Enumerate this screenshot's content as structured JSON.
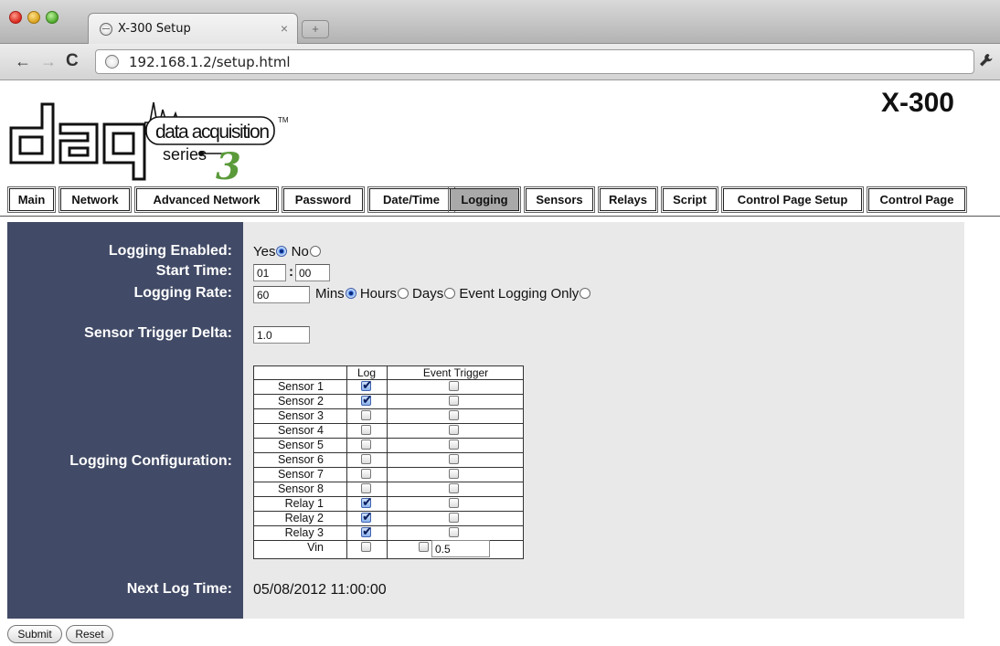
{
  "browser": {
    "tab_title": "X-300 Setup",
    "tab_close": "×",
    "new_tab": "+",
    "url": "192.168.1.2/setup.html",
    "back": "←",
    "forward": "→",
    "reload": "C",
    "wrench": "🔧"
  },
  "header": {
    "logo_letters": "daq",
    "logo_line1": "data acquisition",
    "logo_line2": "series",
    "logo_number": "3",
    "logo_tm": "TM",
    "product": "X-300"
  },
  "nav": {
    "tabs": [
      "Main",
      "Network",
      "Advanced Network",
      "Password",
      "Date/Time",
      "Logging",
      "Sensors",
      "Relays",
      "Script",
      "Control Page Setup",
      "Control Page"
    ],
    "active": "Logging"
  },
  "form": {
    "logging_enabled": {
      "label": "Logging Enabled:",
      "yes": "Yes",
      "no": "No",
      "selected": "Yes"
    },
    "start_time": {
      "label": "Start Time:",
      "hour": "01",
      "sep": ":",
      "minute": "00"
    },
    "logging_rate": {
      "label": "Logging Rate:",
      "value": "60",
      "options": [
        "Mins",
        "Hours",
        "Days",
        "Event Logging Only"
      ],
      "selected": "Mins"
    },
    "sensor_trigger_delta": {
      "label": "Sensor Trigger Delta:",
      "value": "1.0"
    },
    "logging_configuration": {
      "label": "Logging Configuration:",
      "col_log": "Log",
      "col_event": "Event Trigger",
      "rows": [
        {
          "name": "Sensor 1",
          "log": true,
          "event": false
        },
        {
          "name": "Sensor 2",
          "log": true,
          "event": false
        },
        {
          "name": "Sensor 3",
          "log": false,
          "event": false
        },
        {
          "name": "Sensor 4",
          "log": false,
          "event": false
        },
        {
          "name": "Sensor 5",
          "log": false,
          "event": false
        },
        {
          "name": "Sensor 6",
          "log": false,
          "event": false
        },
        {
          "name": "Sensor 7",
          "log": false,
          "event": false
        },
        {
          "name": "Sensor 8",
          "log": false,
          "event": false
        },
        {
          "name": "Relay 1",
          "log": true,
          "event": false
        },
        {
          "name": "Relay 2",
          "log": true,
          "event": false
        },
        {
          "name": "Relay 3",
          "log": true,
          "event": false
        },
        {
          "name": "Vin",
          "log": false,
          "event": false
        }
      ],
      "vin_threshold": "0.5"
    },
    "next_log_time": {
      "label": "Next Log Time:",
      "value": "05/08/2012 11:00:00"
    }
  },
  "buttons": {
    "submit": "Submit",
    "reset": "Reset"
  },
  "colors": {
    "panel_left": "#414a66",
    "panel_right": "#e9e9e9",
    "active_tab": "#a9a9a9",
    "logo_green": "#5a9a3a"
  }
}
